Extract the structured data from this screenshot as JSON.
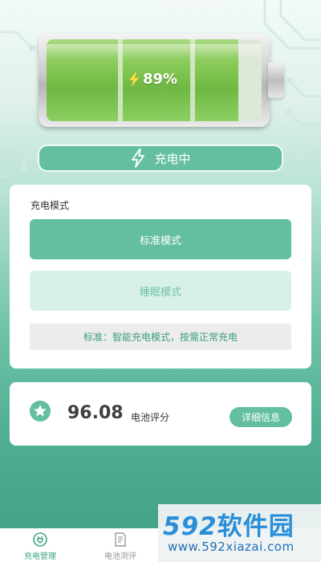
{
  "battery": {
    "percent_label": "89%",
    "level": 0.89,
    "fill_color": "#7fc54f"
  },
  "status": {
    "label": "充电中",
    "icon": "lightning-bolt-icon"
  },
  "mode_card": {
    "title": "充电模式",
    "standard_label": "标准模式",
    "sleep_label": "睡眠模式",
    "description": "标准：智能充电模式，按需正常充电"
  },
  "score_card": {
    "icon": "star-icon",
    "value": "96.08",
    "label": "电池评分",
    "detail_button": "详细信息"
  },
  "bottom_nav": {
    "items": [
      {
        "label": "充电管理",
        "icon": "plug-icon",
        "active": true
      },
      {
        "label": "电池测评",
        "icon": "document-icon",
        "active": false
      }
    ]
  },
  "watermark": {
    "logo_number": "592",
    "logo_text": "软件园",
    "url": "www.592xiazai.com"
  },
  "colors": {
    "accent": "#63bea2",
    "accent_light": "#d8f1e8",
    "active_nav": "#3fa386"
  }
}
